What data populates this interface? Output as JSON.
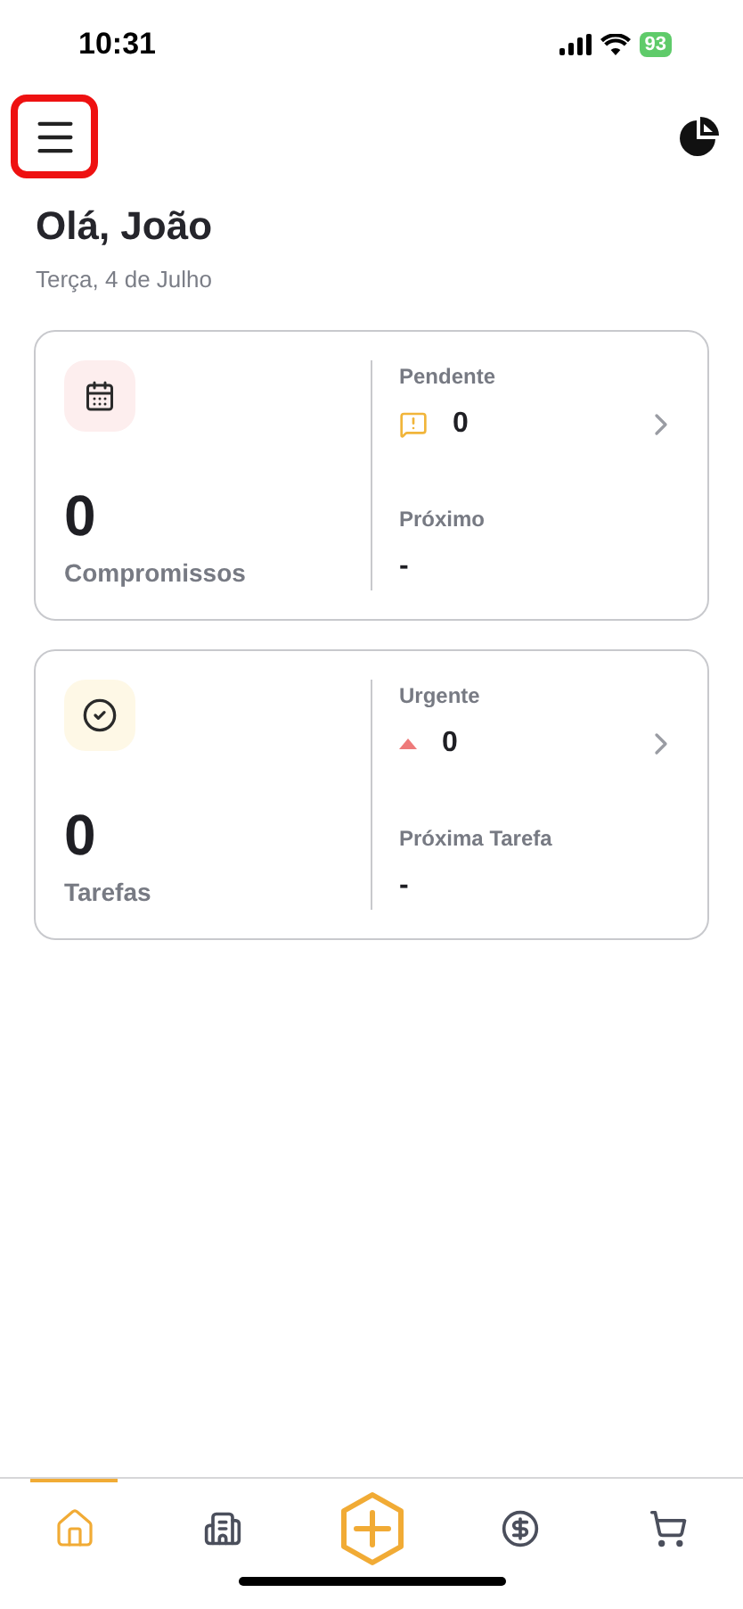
{
  "status_bar": {
    "time": "10:31",
    "battery": "93"
  },
  "header": {
    "menu_highlighted": true
  },
  "greeting": "Olá, João",
  "date": "Terça, 4 de Julho",
  "cards": [
    {
      "kind": "calendar",
      "count": "0",
      "label": "Compromissos",
      "top_label": "Pendente",
      "top_value": "0",
      "bottom_label": "Próximo",
      "bottom_value": "-"
    },
    {
      "kind": "tasks",
      "count": "0",
      "label": "Tarefas",
      "top_label": "Urgente",
      "top_value": "0",
      "bottom_label": "Próxima Tarefa",
      "bottom_value": "-"
    }
  ],
  "nav": [
    {
      "kind": "home",
      "selected": true
    },
    {
      "kind": "building",
      "selected": false
    },
    {
      "kind": "add"
    },
    {
      "kind": "money",
      "selected": false
    },
    {
      "kind": "cart",
      "selected": false
    }
  ]
}
